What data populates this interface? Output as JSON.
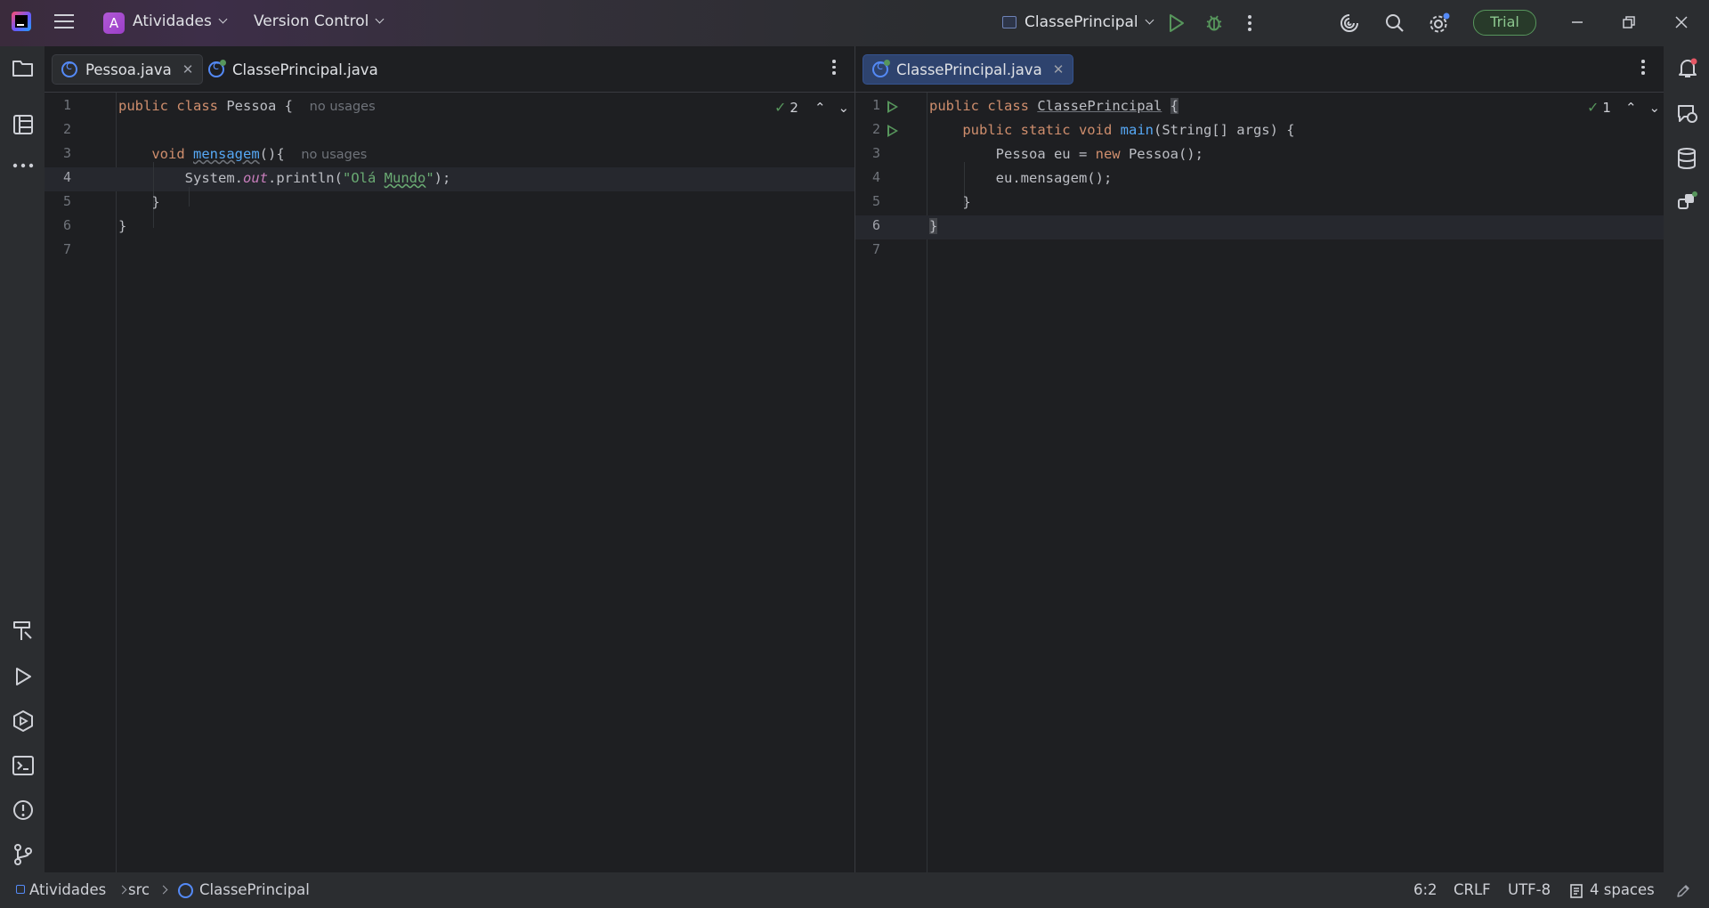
{
  "titlebar": {
    "project_badge": "A",
    "project_name": "Atividades",
    "vcs_label": "Version Control",
    "run_config": "ClassePrincipal",
    "trial_label": "Trial"
  },
  "left_editor": {
    "tabs": [
      {
        "label": "Pessoa.java",
        "active": true
      },
      {
        "label": "ClassePrincipal.java",
        "active": false
      }
    ],
    "inspections": "2",
    "line_numbers": [
      "1",
      "2",
      "3",
      "4",
      "5",
      "6",
      "7"
    ],
    "lines": {
      "l1_kw": "public class",
      "l1_name": "Pessoa",
      "l1_rest": " {",
      "l1_hint": "no usages",
      "l3_kw": "void",
      "l3_fn": "mensagem",
      "l3_rest": "(){",
      "l3_hint": "no usages",
      "l4_a": "System.",
      "l4_field": "out",
      "l4_b": ".println(",
      "l4_str1": "\"Olá ",
      "l4_str2": "Mundo",
      "l4_str3": "\"",
      "l4_c": ");",
      "l5": "}",
      "l6": "}"
    }
  },
  "right_editor": {
    "tabs": [
      {
        "label": "ClassePrincipal.java",
        "active": true
      }
    ],
    "inspections": "1",
    "line_numbers": [
      "1",
      "2",
      "3",
      "4",
      "5",
      "6",
      "7"
    ],
    "lines": {
      "l1_kw": "public class",
      "l1_name": "ClassePrincipal",
      "l1_rest": "{",
      "l2_kw": "public static void",
      "l2_fn": "main",
      "l2_rest": "(String[] args) {",
      "l3_a": "Pessoa eu = ",
      "l3_kw": "new",
      "l3_b": " Pessoa();",
      "l4": "eu.mensagem();",
      "l5": "}",
      "l6": "}"
    }
  },
  "statusbar": {
    "breadcrumb": [
      "Atividades",
      "src",
      "ClassePrincipal"
    ],
    "position": "6:2",
    "line_ending": "CRLF",
    "encoding": "UTF-8",
    "indent": "4 spaces"
  },
  "colors": {
    "accent": "#548af7",
    "run_green": "#57965c",
    "keyword": "#cf8e6d",
    "function": "#56a8f5",
    "string": "#6aab73"
  }
}
